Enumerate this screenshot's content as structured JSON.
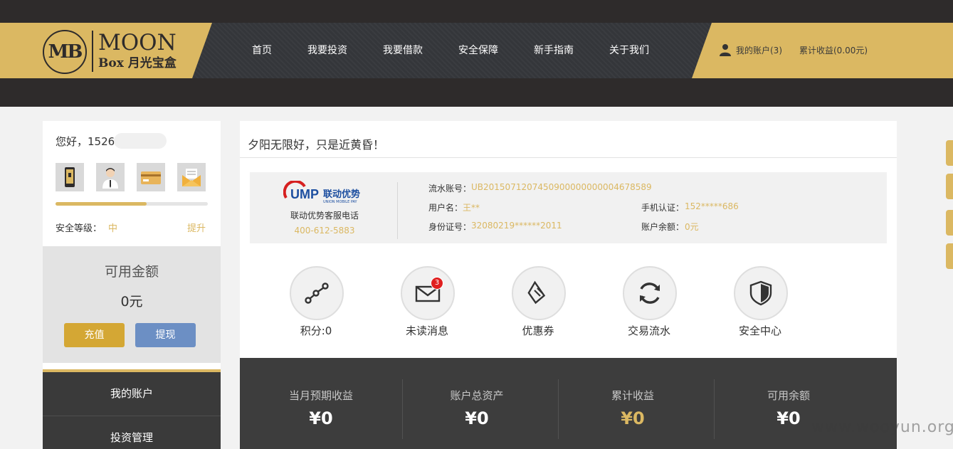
{
  "header": {
    "logo_mark": "MB",
    "logo_en": "MOON",
    "logo_cn": "Box 月光宝盒",
    "nav": [
      "首页",
      "我要投资",
      "我要借款",
      "安全保障",
      "新手指南",
      "关于我们"
    ],
    "account_label": "我的账户(3)",
    "earnings_label": "累计收益(0.00元)"
  },
  "sidebar": {
    "greeting": "您好，1526",
    "quick_icons": [
      "phone-icon",
      "person-icon",
      "card-icon",
      "mail-icon"
    ],
    "security": {
      "label": "安全等级：",
      "level": "中",
      "upgrade": "提升",
      "progress_percent": 60
    },
    "available": {
      "label": "可用金额",
      "value": "0元"
    },
    "buttons": {
      "recharge": "充值",
      "withdraw": "提现"
    },
    "menu": [
      "我的账户",
      "投资管理"
    ]
  },
  "main": {
    "motto": "夕阳无限好，只是近黄昏！",
    "ump": {
      "logo_text": "UMP联动优势",
      "logo_sub": "UNION MOBILE PAY",
      "hotline_label": "联动优势客服电话",
      "hotline": "400-612-5883"
    },
    "info": {
      "serial_label": "流水账号：",
      "serial": "UB2015071207450900000000004678589",
      "username_label": "用户名：",
      "username": "王**",
      "phone_label": "手机认证：",
      "phone": "152*****686",
      "idcard_label": "身份证号：",
      "idcard": "32080219******2011",
      "balance_label": "账户余额：",
      "balance": "0元"
    },
    "features": [
      {
        "label": "积分:0",
        "icon": "points-icon"
      },
      {
        "label": "未读消息",
        "icon": "envelope-icon",
        "badge": "3"
      },
      {
        "label": "优惠券",
        "icon": "coupon-icon"
      },
      {
        "label": "交易流水",
        "icon": "refresh-icon"
      },
      {
        "label": "安全中心",
        "icon": "shield-icon"
      }
    ],
    "stats": [
      {
        "label": "当月预期收益",
        "value": "¥0",
        "color": "#ffffff"
      },
      {
        "label": "账户总资产",
        "value": "¥0",
        "color": "#ffffff"
      },
      {
        "label": "累计收益",
        "value": "¥0",
        "color": "#dbb862"
      },
      {
        "label": "可用余额",
        "value": "¥0",
        "color": "#ffffff"
      }
    ]
  },
  "watermark": "www.wooyun.org",
  "colors": {
    "gold": "#dbb862",
    "dark": "#2e2b2b",
    "recharge": "#d4a734",
    "withdraw": "#6c8fc4",
    "badge": "#e02020"
  }
}
